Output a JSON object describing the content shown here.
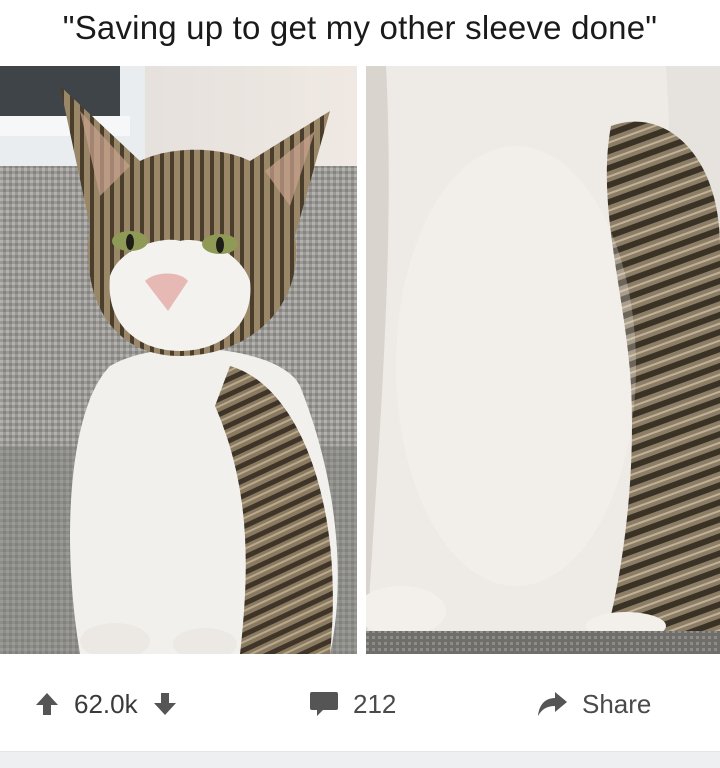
{
  "post": {
    "title": "\"Saving up to get my other sleeve done\"",
    "image_left_label": "cat-photo",
    "image_right_label": "cat-photo-zoomed"
  },
  "actions": {
    "score": "62.0k",
    "comment_count": "212",
    "share_label": "Share"
  },
  "icons": {
    "upvote": "arrow-up-icon",
    "downvote": "arrow-down-icon",
    "comment": "comment-bubble-icon",
    "share": "share-arrow-icon"
  },
  "colors": {
    "text": "#1a1a1b",
    "action_text": "#4a4a4a",
    "icon": "#555555",
    "footer": "#eeeff1"
  }
}
